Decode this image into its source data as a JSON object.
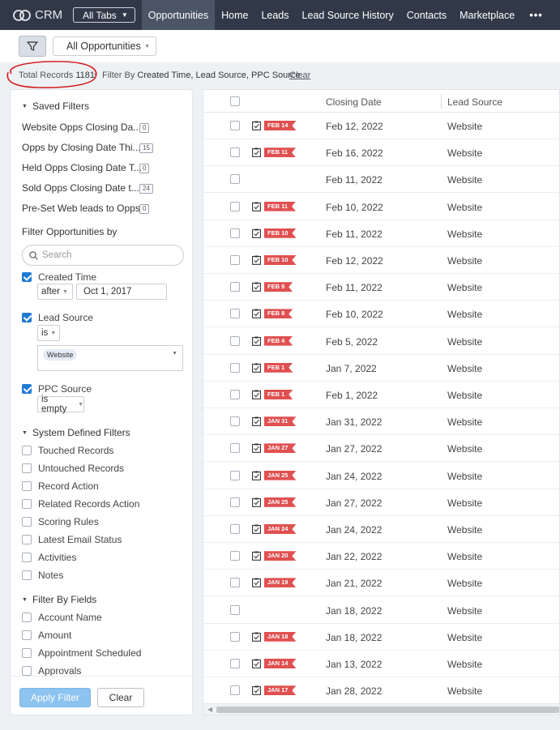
{
  "app": {
    "name": "CRM"
  },
  "nav": {
    "all_tabs": "All Tabs",
    "tabs": [
      "Opportunities",
      "Home",
      "Leads",
      "Lead Source History",
      "Contacts",
      "Marketplace"
    ],
    "active_tab": "Opportunities",
    "more": "•••"
  },
  "toolbar": {
    "view": "All Opportunities"
  },
  "summary": {
    "total_label": "Total Records",
    "total_count": "1181",
    "filter_by_label": "Filter By",
    "filter_fields": "Created Time, Lead Source, PPC Source",
    "clear": "Clear"
  },
  "sidebar": {
    "saved_filters_title": "Saved Filters",
    "saved_filters": [
      {
        "label": "Website Opps Closing Da...",
        "count": "0"
      },
      {
        "label": "Opps by Closing Date Thi...",
        "count": "15"
      },
      {
        "label": "Held Opps Closing Date T...",
        "count": "0"
      },
      {
        "label": "Sold Opps Closing Date t...",
        "count": "24"
      },
      {
        "label": "Pre-Set Web leads to Opps",
        "count": "0"
      }
    ],
    "filter_by_title": "Filter Opportunities by",
    "search_placeholder": "Search",
    "created_time": {
      "label": "Created Time",
      "operator": "after",
      "value": "Oct 1, 2017"
    },
    "lead_source": {
      "label": "Lead Source",
      "operator": "is",
      "value": "Website"
    },
    "ppc_source": {
      "label": "PPC Source",
      "operator": "is empty"
    },
    "system_title": "System Defined Filters",
    "system_filters": [
      "Touched Records",
      "Untouched Records",
      "Record Action",
      "Related Records Action",
      "Scoring Rules",
      "Latest Email Status",
      "Activities",
      "Notes"
    ],
    "fields_title": "Filter By Fields",
    "field_filters": [
      "Account Name",
      "Amount",
      "Appointment Scheduled",
      "Approvals"
    ],
    "apply": "Apply Filter",
    "clear": "Clear"
  },
  "table": {
    "columns": [
      "Closing Date",
      "Lead Source"
    ],
    "rows": [
      {
        "tag": "FEB 14",
        "closing": "Feb 12, 2022",
        "source": "Website"
      },
      {
        "tag": "FEB 11",
        "closing": "Feb 16, 2022",
        "source": "Website"
      },
      {
        "tag": "",
        "closing": "Feb 11, 2022",
        "source": "Website"
      },
      {
        "tag": "FEB 11",
        "closing": "Feb 10, 2022",
        "source": "Website"
      },
      {
        "tag": "FEB 10",
        "closing": "Feb 11, 2022",
        "source": "Website"
      },
      {
        "tag": "FEB 10",
        "closing": "Feb 12, 2022",
        "source": "Website"
      },
      {
        "tag": "FEB 9",
        "closing": "Feb 11, 2022",
        "source": "Website"
      },
      {
        "tag": "FEB 8",
        "closing": "Feb 10, 2022",
        "source": "Website"
      },
      {
        "tag": "FEB 4",
        "closing": "Feb 5, 2022",
        "source": "Website"
      },
      {
        "tag": "FEB 1",
        "closing": "Jan 7, 2022",
        "source": "Website"
      },
      {
        "tag": "FEB 1",
        "closing": "Feb 1, 2022",
        "source": "Website"
      },
      {
        "tag": "JAN 31",
        "closing": "Jan 31, 2022",
        "source": "Website"
      },
      {
        "tag": "JAN 27",
        "closing": "Jan 27, 2022",
        "source": "Website"
      },
      {
        "tag": "JAN 25",
        "closing": "Jan 24, 2022",
        "source": "Website"
      },
      {
        "tag": "JAN 25",
        "closing": "Jan 27, 2022",
        "source": "Website"
      },
      {
        "tag": "JAN 24",
        "closing": "Jan 24, 2022",
        "source": "Website"
      },
      {
        "tag": "JAN 20",
        "closing": "Jan 22, 2022",
        "source": "Website"
      },
      {
        "tag": "JAN 19",
        "closing": "Jan 21, 2022",
        "source": "Website"
      },
      {
        "tag": "",
        "closing": "Jan 18, 2022",
        "source": "Website"
      },
      {
        "tag": "JAN 18",
        "closing": "Jan 18, 2022",
        "source": "Website"
      },
      {
        "tag": "JAN 14",
        "closing": "Jan 13, 2022",
        "source": "Website"
      },
      {
        "tag": "JAN 17",
        "closing": "Jan 28, 2022",
        "source": "Website"
      }
    ]
  },
  "colors": {
    "nav_bg": "#313949",
    "active_tab": "#4b5566",
    "tag": "#e05050",
    "checkbox": "#1f7ad4",
    "apply": "#8cc3ef",
    "annotation": "#d42020"
  }
}
